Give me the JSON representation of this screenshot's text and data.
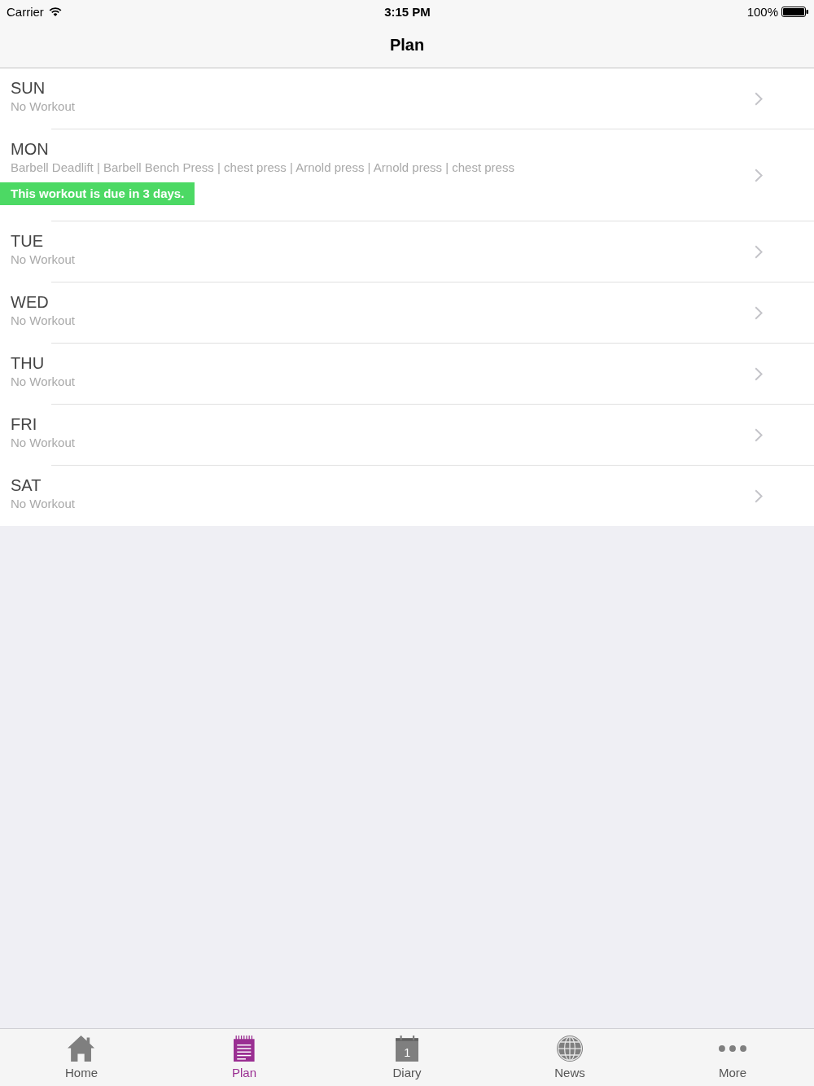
{
  "status_bar": {
    "carrier": "Carrier",
    "time": "3:15 PM",
    "battery": "100%"
  },
  "nav_bar": {
    "title": "Plan"
  },
  "days": [
    {
      "day": "SUN",
      "summary": "No Workout"
    },
    {
      "day": "MON",
      "summary": "Barbell Deadlift | Barbell Bench Press | chest press | Arnold press | Arnold press | chest press",
      "notice": "This workout is due in 3 days."
    },
    {
      "day": "TUE",
      "summary": "No Workout"
    },
    {
      "day": "WED",
      "summary": "No Workout"
    },
    {
      "day": "THU",
      "summary": "No Workout"
    },
    {
      "day": "FRI",
      "summary": "No Workout"
    },
    {
      "day": "SAT",
      "summary": "No Workout"
    }
  ],
  "tab_bar": [
    {
      "kind": "home",
      "label": "Home",
      "selected": false
    },
    {
      "kind": "plan",
      "label": "Plan",
      "selected": true
    },
    {
      "kind": "diary",
      "label": "Diary",
      "selected": false,
      "icon_text": "1"
    },
    {
      "kind": "news",
      "label": "News",
      "selected": false
    },
    {
      "kind": "more",
      "label": "More",
      "selected": false
    }
  ]
}
